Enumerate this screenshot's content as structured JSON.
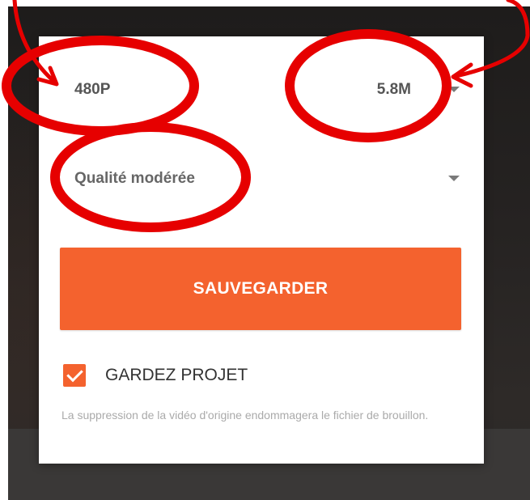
{
  "dialog": {
    "resolution": "480P",
    "file_size": "5.8M",
    "quality": "Qualité modérée",
    "save_label": "SAUVEGARDER",
    "keep_project_label": "GARDEZ PROJET",
    "keep_project_checked": true,
    "hint": "La suppression de la vidéo d'origine endommagera le fichier de brouillon."
  },
  "icons": {
    "size_dropdown": "chevron-down-icon",
    "quality_dropdown": "chevron-down-icon",
    "checkbox": "checkmark-icon"
  },
  "colors": {
    "accent": "#f4622e",
    "annotation": "#e60000"
  }
}
